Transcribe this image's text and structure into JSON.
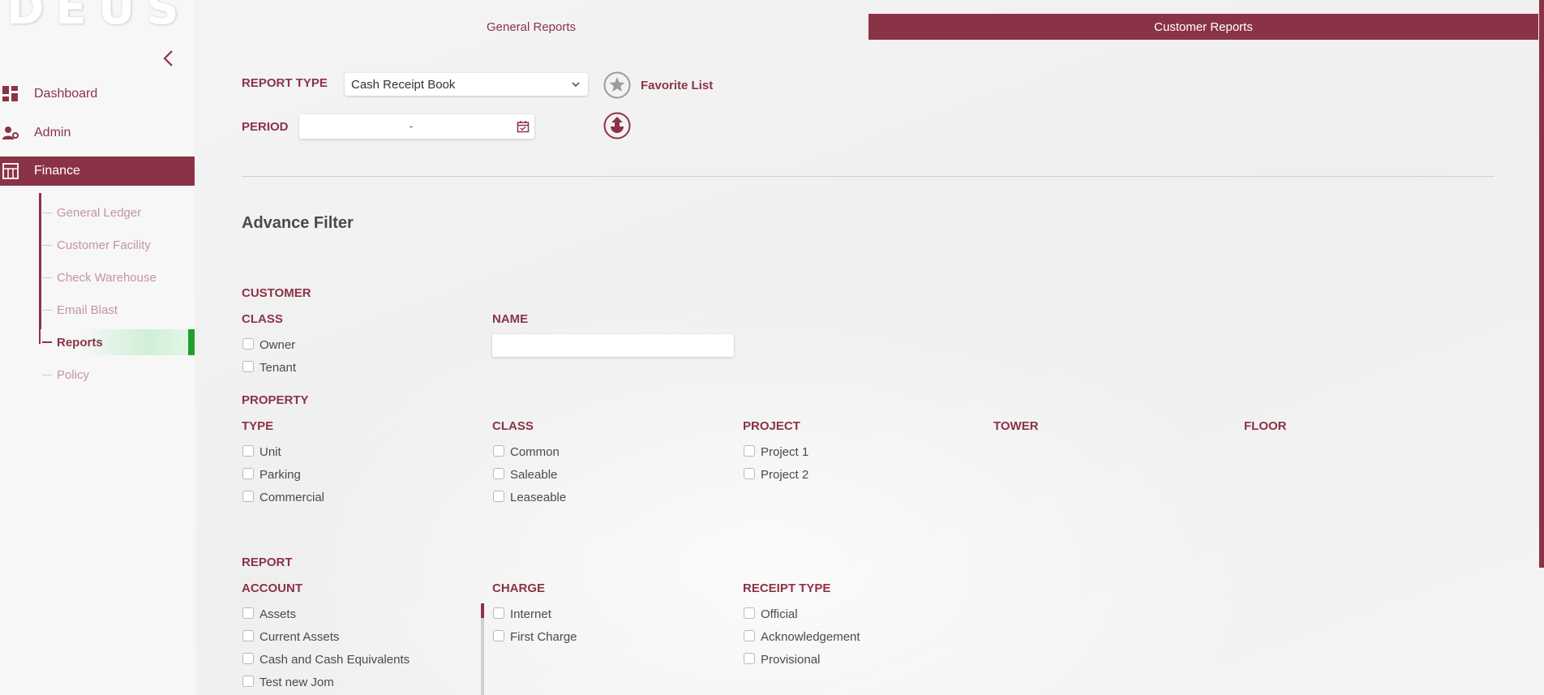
{
  "logo": {
    "text": "DEUS"
  },
  "sidebar": {
    "items": [
      {
        "label": "Dashboard",
        "icon": "dashboard-icon"
      },
      {
        "label": "Admin",
        "icon": "admin-icon"
      },
      {
        "label": "Finance",
        "icon": "finance-icon",
        "active": true
      }
    ],
    "finance_sub": [
      {
        "label": "General Ledger"
      },
      {
        "label": "Customer Facility"
      },
      {
        "label": "Check Warehouse"
      },
      {
        "label": "Email Blast"
      },
      {
        "label": "Reports",
        "active": true
      },
      {
        "label": "Policy"
      }
    ]
  },
  "tabs": {
    "general": "General Reports",
    "customer": "Customer Reports",
    "active": "customer"
  },
  "report": {
    "type_label": "REPORT TYPE",
    "type_value": "Cash Receipt Book",
    "period_label": "PERIOD",
    "period_value": "-",
    "favorite_label": "Favorite List"
  },
  "advance_filter": {
    "title": "Advance Filter",
    "customer": {
      "heading": "CUSTOMER",
      "class_label": "CLASS",
      "class_options": [
        "Owner",
        "Tenant"
      ],
      "name_label": "NAME",
      "name_value": ""
    },
    "property": {
      "heading": "PROPERTY",
      "type_label": "TYPE",
      "type_options": [
        "Unit",
        "Parking",
        "Commercial"
      ],
      "class_label": "CLASS",
      "class_options": [
        "Common",
        "Saleable",
        "Leaseable"
      ],
      "project_label": "PROJECT",
      "project_options": [
        "Project 1",
        "Project 2"
      ],
      "tower_label": "TOWER",
      "floor_label": "FLOOR"
    },
    "report": {
      "heading": "REPORT",
      "account_label": "ACCOUNT",
      "account_options": [
        "Assets",
        "Current Assets",
        "Cash and Cash Equivalents",
        "Test new Jom"
      ],
      "charge_label": "CHARGE",
      "charge_options": [
        "Internet",
        "First Charge"
      ],
      "receipt_label": "RECEIPT TYPE",
      "receipt_options": [
        "Official",
        "Acknowledgement",
        "Provisional"
      ]
    }
  },
  "colors": {
    "brand": "#8b3346",
    "active_indicator": "#1fa02c"
  }
}
